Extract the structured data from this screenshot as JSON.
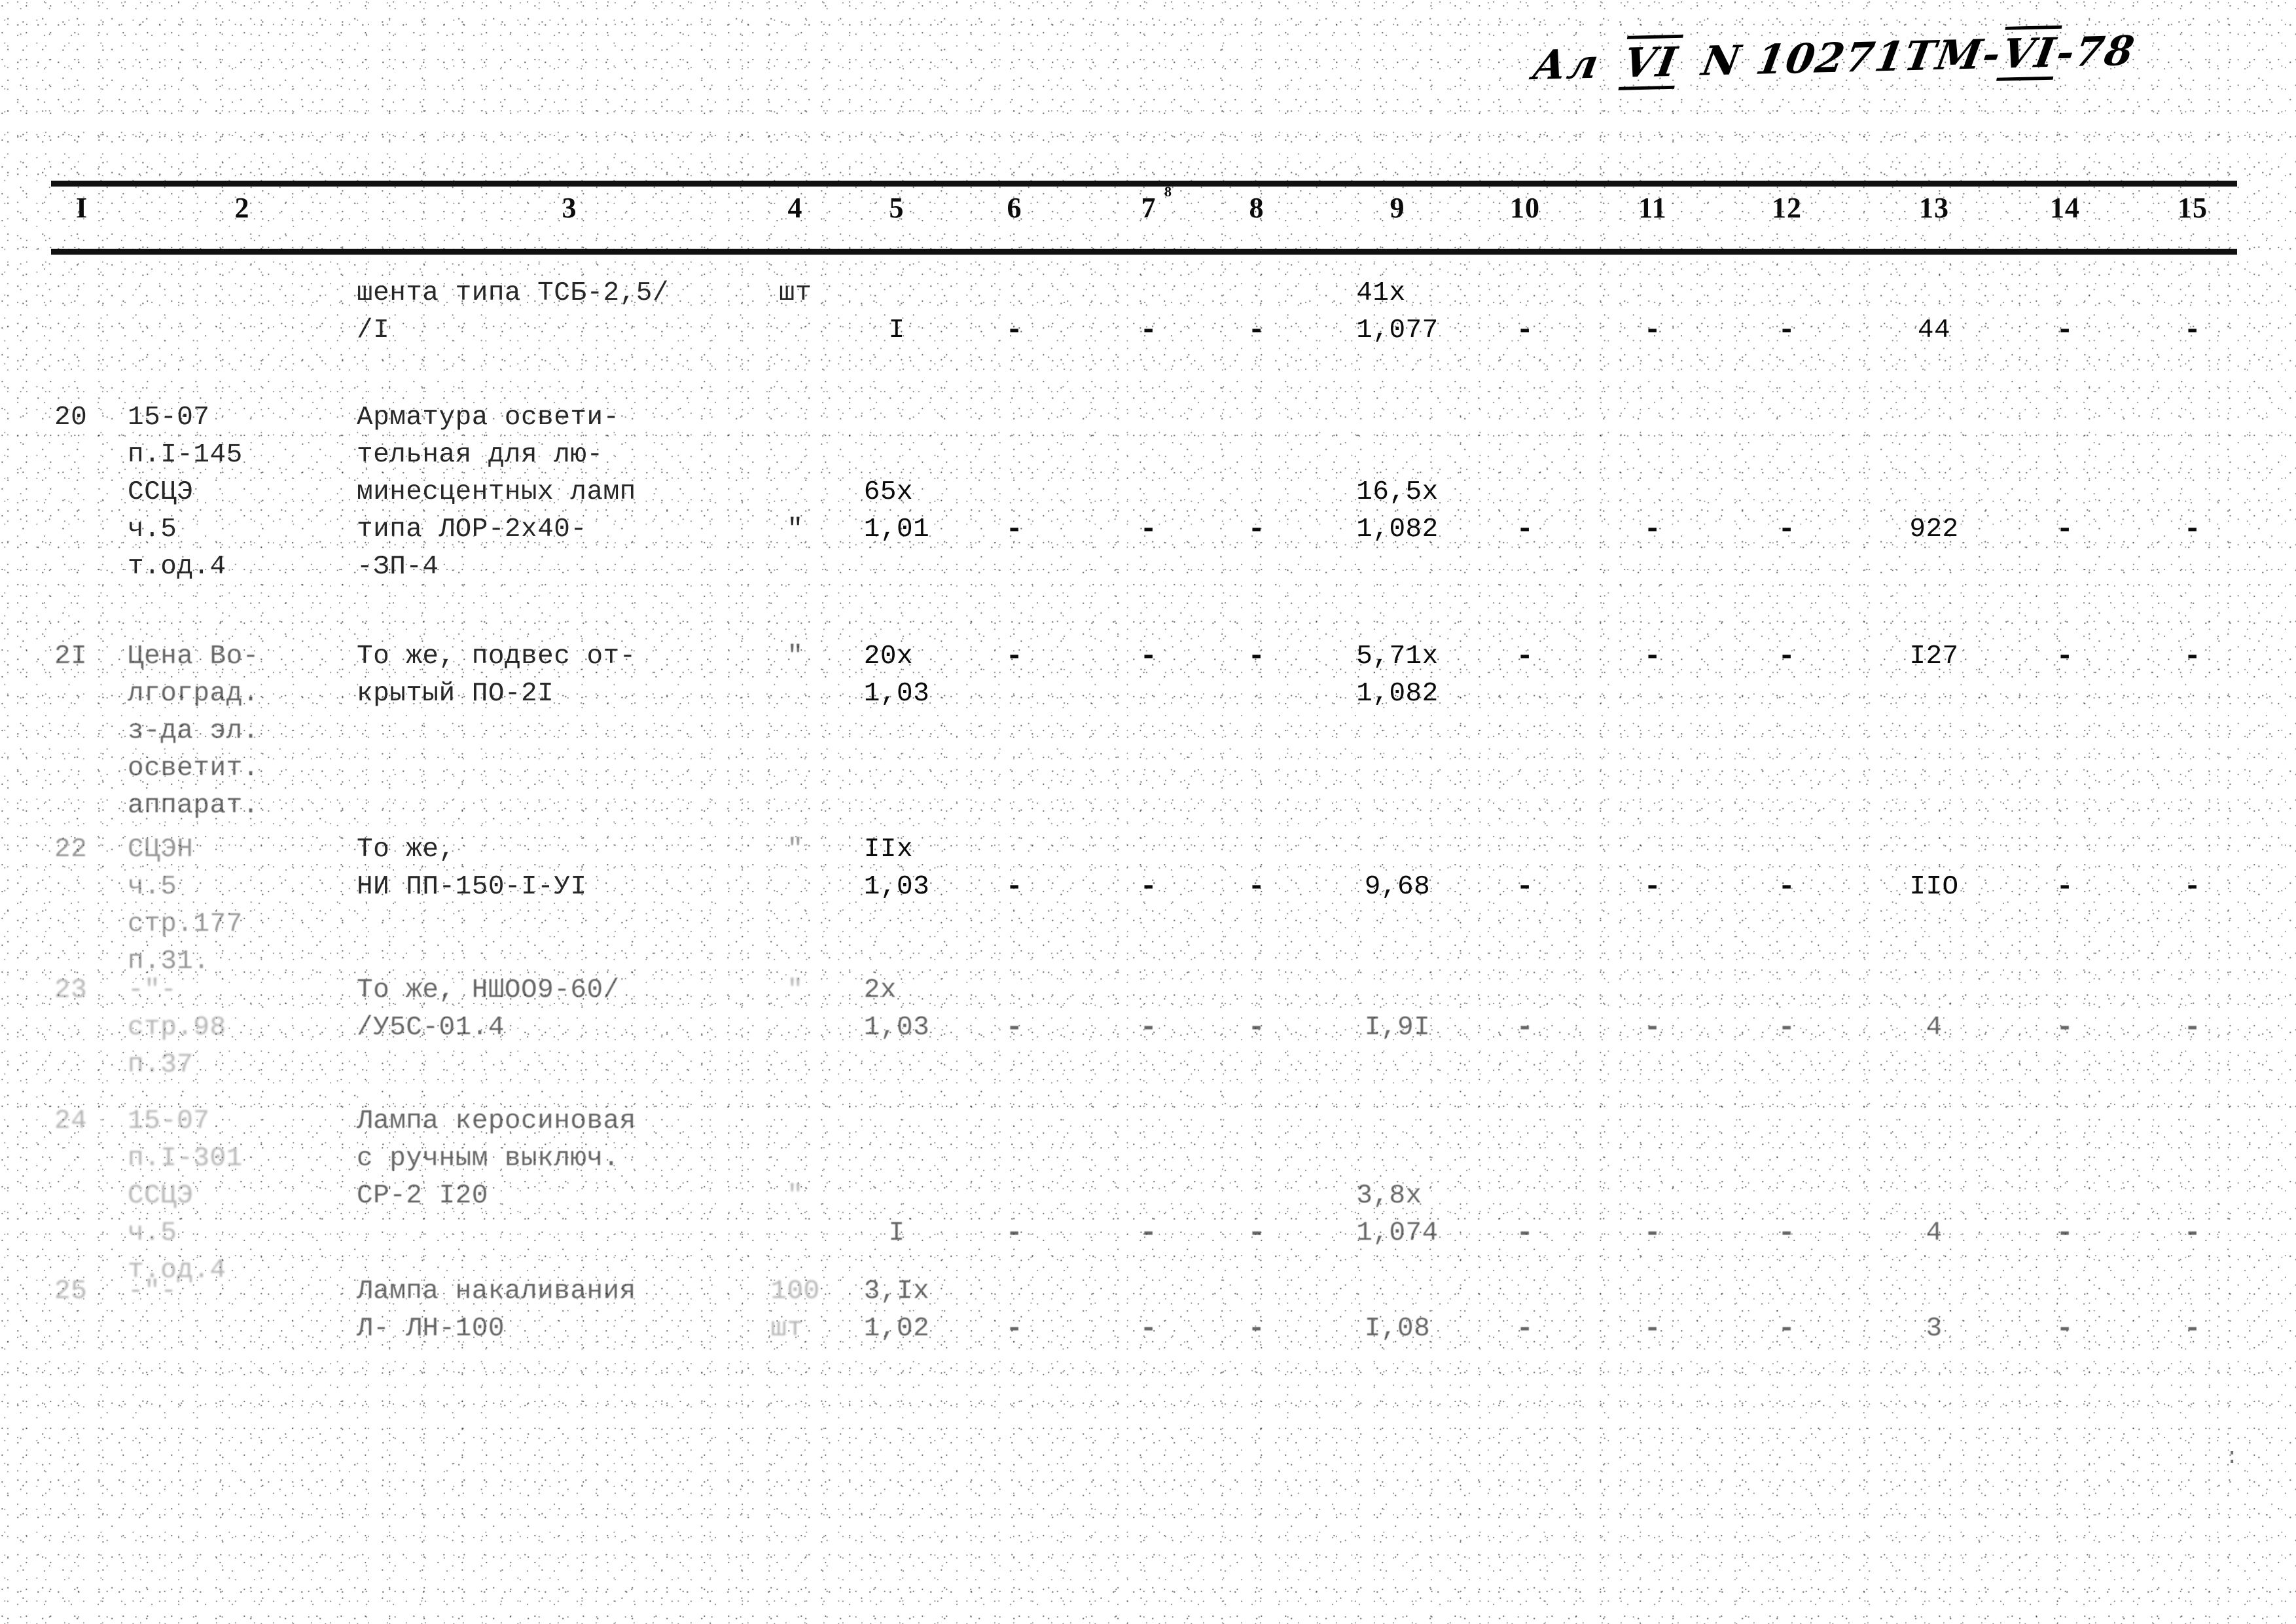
{
  "document": {
    "handwritten_header": {
      "prefix": "Ал",
      "volume": "VI",
      "number": "N 10271ТМ-",
      "part": "VI",
      "year": "-78"
    },
    "margin_ticks": ":"
  },
  "table": {
    "column_headers": [
      "I",
      "2",
      "3",
      "4",
      "5",
      "6",
      "7",
      "8",
      "9",
      "10",
      "11",
      "12",
      "13",
      "14",
      "15"
    ],
    "column_header_superscript": "8",
    "rows": [
      {
        "n": "",
        "ref": "",
        "description": [
          "шента типа ТСБ-2,5/",
          "/I"
        ],
        "unit": "шт",
        "qty": [
          "",
          "I"
        ],
        "c6": [
          "",
          "-"
        ],
        "c7": [
          "",
          "-"
        ],
        "c8": [
          "",
          "-"
        ],
        "c9": [
          "41х",
          "1,077"
        ],
        "c10": [
          "",
          "-"
        ],
        "c11": [
          "",
          "-"
        ],
        "c12": [
          "",
          "-"
        ],
        "c13": [
          "",
          "44"
        ],
        "c14": [
          "",
          "-"
        ],
        "c15": [
          "",
          "-"
        ]
      },
      {
        "n": "20",
        "ref": [
          "15-07",
          "п.I-145",
          "ССЦЭ",
          "ч.5",
          "т.од.4"
        ],
        "description": [
          "Арматура освети-",
          "тельная для лю-",
          "минесцентных ламп",
          "типа ЛОР-2х40-",
          "-ЗП-4"
        ],
        "unit": "\"",
        "qty": [
          "65х",
          "1,01"
        ],
        "c6": [
          "",
          "-"
        ],
        "c7": [
          "",
          "-"
        ],
        "c8": [
          "",
          "-"
        ],
        "c9": [
          "16,5х",
          "1,082"
        ],
        "c10": [
          "",
          "-"
        ],
        "c11": [
          "",
          "-"
        ],
        "c12": [
          "",
          "-"
        ],
        "c13": [
          "",
          "922"
        ],
        "c14": [
          "",
          "-"
        ],
        "c15": [
          "",
          "-"
        ]
      },
      {
        "n": "2I",
        "ref": [
          "Цена Во-",
          "лгоград.",
          "з-да эл.",
          "осветит.",
          "аппарат."
        ],
        "description": [
          "То же, подвес от-",
          "крытый ПО-2I"
        ],
        "unit": "\"",
        "qty": [
          "20х",
          "1,03"
        ],
        "c6": [
          "-",
          ""
        ],
        "c7": [
          "-",
          ""
        ],
        "c8": [
          "-",
          ""
        ],
        "c9": [
          "5,71х",
          "1,082"
        ],
        "c10": [
          "-",
          ""
        ],
        "c11": [
          "-",
          ""
        ],
        "c12": [
          "-",
          ""
        ],
        "c13": [
          "I27",
          ""
        ],
        "c14": [
          "-",
          ""
        ],
        "c15": [
          "-",
          ""
        ]
      },
      {
        "n": "22",
        "ref": [
          "СЦЭН",
          "ч.5",
          "стр.177",
          "п.31."
        ],
        "description": [
          "То же,",
          "НИ ПП-150-I-УI"
        ],
        "unit": "\"",
        "qty": [
          "IIх",
          "1,03"
        ],
        "c6": [
          "",
          "-"
        ],
        "c7": [
          "",
          "-"
        ],
        "c8": [
          "",
          "-"
        ],
        "c9": [
          "",
          "9,68"
        ],
        "c10": [
          "",
          "-"
        ],
        "c11": [
          "",
          "-"
        ],
        "c12": [
          "",
          "-"
        ],
        "c13": [
          "",
          "IIО"
        ],
        "c14": [
          "",
          "-"
        ],
        "c15": [
          "",
          "-"
        ]
      },
      {
        "n": "23",
        "ref": [
          "-\"-",
          "стр.98",
          "п.37"
        ],
        "description": [
          "То же, НШОО9-60/",
          "/У5С-01.4"
        ],
        "unit": "\"",
        "qty": [
          "2х",
          "1,03"
        ],
        "c6": [
          "",
          "-"
        ],
        "c7": [
          "",
          "-"
        ],
        "c8": [
          "",
          "-"
        ],
        "c9": [
          "",
          "I,9I"
        ],
        "c10": [
          "",
          "-"
        ],
        "c11": [
          "",
          "-"
        ],
        "c12": [
          "",
          "-"
        ],
        "c13": [
          "",
          "4"
        ],
        "c14": [
          "",
          "-"
        ],
        "c15": [
          "",
          "-"
        ]
      },
      {
        "n": "24",
        "ref": [
          "15-07",
          "п.I-301",
          "ССЦЭ",
          "ч.5",
          "т.од.4"
        ],
        "description": [
          "Лампа керосиновая",
          "с ручным выключ.",
          "СР-2 I20"
        ],
        "unit": "\"",
        "qty": [
          "",
          "I"
        ],
        "c6": [
          "",
          "-"
        ],
        "c7": [
          "",
          "-"
        ],
        "c8": [
          "",
          "-"
        ],
        "c9": [
          "3,8х",
          "1,074"
        ],
        "c10": [
          "",
          "-"
        ],
        "c11": [
          "",
          "-"
        ],
        "c12": [
          "",
          "-"
        ],
        "c13": [
          "",
          "4"
        ],
        "c14": [
          "",
          "-"
        ],
        "c15": [
          "",
          "-"
        ]
      },
      {
        "n": "25",
        "ref": [
          "-\"-"
        ],
        "description": [
          "Лампа накаливания",
          "Л- ЛН-100"
        ],
        "unit": [
          "100",
          "шт"
        ],
        "qty": [
          "3,Iх",
          "1,02"
        ],
        "c6": [
          "",
          "-"
        ],
        "c7": [
          "",
          "-"
        ],
        "c8": [
          "",
          "-"
        ],
        "c9": [
          "",
          "I,08"
        ],
        "c10": [
          "",
          "-"
        ],
        "c11": [
          "",
          "-"
        ],
        "c12": [
          "",
          "-"
        ],
        "c13": [
          "",
          "3"
        ],
        "c14": [
          "",
          "-"
        ],
        "c15": [
          "",
          "-"
        ]
      }
    ]
  }
}
